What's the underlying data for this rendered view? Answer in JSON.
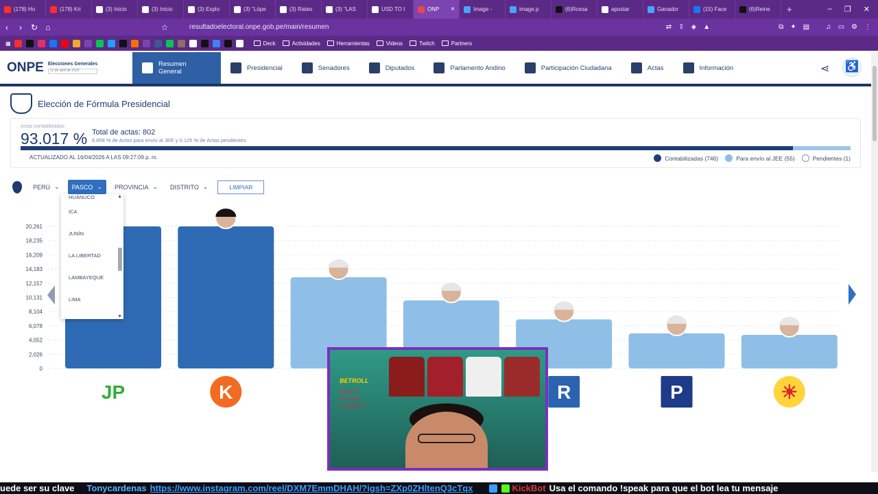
{
  "browser": {
    "tabs": [
      {
        "label": "(178) Ho",
        "color": "#ff2d2d"
      },
      {
        "label": "(178) Kri",
        "color": "#ff2d2d"
      },
      {
        "label": "(3) Inicio",
        "color": "#ffffff"
      },
      {
        "label": "(3) Inicio",
        "color": "#ffffff"
      },
      {
        "label": "(3) Explo",
        "color": "#ffffff"
      },
      {
        "label": "(3) \"Lópe",
        "color": "#ffffff"
      },
      {
        "label": "(3) Rateo",
        "color": "#ffffff"
      },
      {
        "label": "(3) \"LAS",
        "color": "#ffffff"
      },
      {
        "label": "USD TO I",
        "color": "#ffffff"
      },
      {
        "label": "ONP",
        "color": "#e5484d",
        "active": true
      },
      {
        "label": "Image -",
        "color": "#4aa3ff"
      },
      {
        "label": "image.p",
        "color": "#4aa3ff"
      },
      {
        "label": "(6)Rcesa",
        "color": "#111111"
      },
      {
        "label": "apostar",
        "color": "#ffffff"
      },
      {
        "label": "Ganador",
        "color": "#4aa3ff"
      },
      {
        "label": "(15) Face",
        "color": "#1877f2"
      },
      {
        "label": "(6)Reine",
        "color": "#111111"
      }
    ],
    "new_tab": "+",
    "window_controls": [
      "–",
      "❐",
      "✕"
    ],
    "url": "resultadoelectoral.onpe.gob.pe/main/resumen",
    "bookmarks": {
      "folders": [
        "Deck",
        "Actividades",
        "Herramientas",
        "Videos",
        "Twitch",
        "Partners"
      ],
      "icon_colors": [
        "#ff2d2d",
        "#111111",
        "#e1306c",
        "#1877f2",
        "#ff0000",
        "#f5a623",
        "#7b44b0",
        "#00c853",
        "#1da1f2",
        "#111111",
        "#ff6f00",
        "#7b44b0",
        "#3b5998",
        "#00c853",
        "#8d6e63",
        "#ffffff",
        "#111111",
        "#3b82f6",
        "#111111",
        "#ffffff"
      ]
    }
  },
  "site": {
    "logo_text": "ONPE",
    "logo_title": "Elecciones Generales",
    "logo_date": "12 de abril de 2026",
    "menu": [
      {
        "label": "Resumen General",
        "active": true
      },
      {
        "label": "Presidencial"
      },
      {
        "label": "Senadores"
      },
      {
        "label": "Diputados"
      },
      {
        "label": "Parlamento Andino"
      },
      {
        "label": "Participación Ciudadana"
      },
      {
        "label": "Actas"
      },
      {
        "label": "Información"
      }
    ]
  },
  "section_title": "Elección de Fórmula Presidencial",
  "summary": {
    "actas_label": "Actas contabilizadas",
    "actas_pct": "93.017 %",
    "actas_pct_value": 0.93017,
    "total_actas": "Total de actas: 802",
    "sub": "6.858 % de Actos para envío al JEE y 0.125 % de Actas pendientes",
    "updated": "ACTUALIZADO AL 16/04/2026 A LAS 09:27:09 p. m.",
    "legend": [
      {
        "label": "Contabilizadas (746)",
        "color": "#1f3e78"
      },
      {
        "label": "Para envío al JEE (55)",
        "color": "#8fbfe6"
      },
      {
        "label": "Pendientes (1)",
        "color": "#ffffff"
      }
    ]
  },
  "filters": {
    "items": [
      {
        "label": "PERÚ",
        "active": false
      },
      {
        "label": "PASCO",
        "active": true
      },
      {
        "label": "PROVINCIA",
        "active": false
      },
      {
        "label": "DISTRITO",
        "active": false
      }
    ],
    "clear": "LIMPIAR"
  },
  "dropdown": {
    "items": [
      "HUÁNUCO",
      "ICA",
      "JUNÍN",
      "LA LIBERTAD",
      "LAMBAYEQUE",
      "LIMA"
    ]
  },
  "chart_data": {
    "type": "bar",
    "y_ticks": [
      "0",
      "2,026",
      "4,052",
      "6,078",
      "8,104",
      "10,131",
      "12,157",
      "14,183",
      "16,209",
      "18,235",
      "20,261"
    ],
    "ylim": [
      0,
      20261
    ],
    "values": [
      20261,
      20261,
      13000,
      9700,
      7000,
      5000,
      4800
    ],
    "colors": [
      "#2f6bb5",
      "#2f6bb5",
      "#8fbfe6",
      "#8fbfe6",
      "#8fbfe6",
      "#8fbfe6",
      "#8fbfe6"
    ],
    "logos": [
      {
        "text": "JP",
        "bg": "#ffffff",
        "fg": "#2fae3b"
      },
      {
        "text": "K",
        "bg": "#f26b21",
        "fg": "#ffffff"
      },
      {
        "text": "",
        "bg": "#ffffff",
        "fg": "#ffffff"
      },
      {
        "text": "",
        "bg": "#ffffff",
        "fg": "#ffffff"
      },
      {
        "text": "R",
        "bg": "#2b63b0",
        "fg": "#ffffff"
      },
      {
        "text": "P",
        "bg": "#1e3a8a",
        "fg": "#ffffff"
      },
      {
        "text": "☀",
        "bg": "#ffd43b",
        "fg": "#d62828"
      }
    ]
  },
  "overlay": {
    "brand": "BETROLL",
    "note": "Subs  Sí Kc.espe Incognit0.1"
  },
  "ticker": {
    "lead": "uede ser su clave",
    "user": "Tonycardenas",
    "link": "https://www.instagram.com/reel/DXM7EmmDHAH/?igsh=ZXp0ZHltenQ3cTqx",
    "bot": "KickBot",
    "message": "Usa el comando !speak para que el bot lea tu mensaje"
  }
}
